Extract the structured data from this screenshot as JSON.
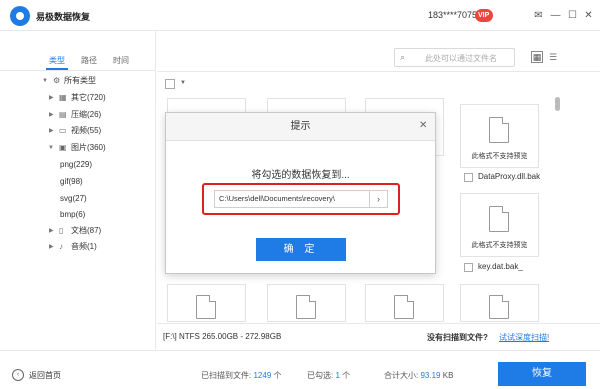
{
  "app": {
    "title": "易极数据恢复",
    "phone": "183****7075",
    "vip": "VIP"
  },
  "sidebar": {
    "tabs": [
      "类型",
      "路径",
      "时间"
    ],
    "tree": [
      {
        "label": "所有类型",
        "icon": "gear-icon"
      },
      {
        "label": "其它(720)",
        "icon": "grid-icon"
      },
      {
        "label": "压缩(26)",
        "icon": "archive-icon"
      },
      {
        "label": "视频(55)",
        "icon": "video-icon"
      },
      {
        "label": "图片(360)",
        "icon": "image-icon"
      },
      {
        "label": "png(229)"
      },
      {
        "label": "gif(98)"
      },
      {
        "label": "svg(27)"
      },
      {
        "label": "bmp(6)"
      },
      {
        "label": "文档(87)",
        "icon": "document-icon"
      },
      {
        "label": "音频(1)",
        "icon": "music-icon"
      }
    ]
  },
  "main": {
    "search_placeholder": "此处可以通过文件名",
    "cards": [
      {
        "caption": "此格式不支持预览",
        "name": "DataProxy.dll.bak"
      },
      {
        "caption": "此格式不支持预览",
        "name": "key.dat.bak_"
      }
    ],
    "drive_info": "[F:\\] NTFS 265.00GB - 272.98GB",
    "no_result": "没有扫描到文件?",
    "deep_scan": "试试深度扫描!"
  },
  "dialog": {
    "title": "提示",
    "message": "将勾选的数据恢复到...",
    "path": "C:\\Users\\dell\\Documents\\recovery\\",
    "ok": "确 定"
  },
  "bottom": {
    "home": "返回首页",
    "scanned_label": "已扫描到文件:",
    "scanned_count": "1249",
    "scanned_unit": "个",
    "selected_label": "已勾选:",
    "selected_count": "1",
    "selected_unit": "个",
    "total_label": "合计大小:",
    "total_size": "93.19",
    "total_unit": "KB",
    "recover": "恢复"
  },
  "colors": {
    "accent": "#1f7be5",
    "vip": "#f0453a",
    "highlight": "#e02020"
  }
}
